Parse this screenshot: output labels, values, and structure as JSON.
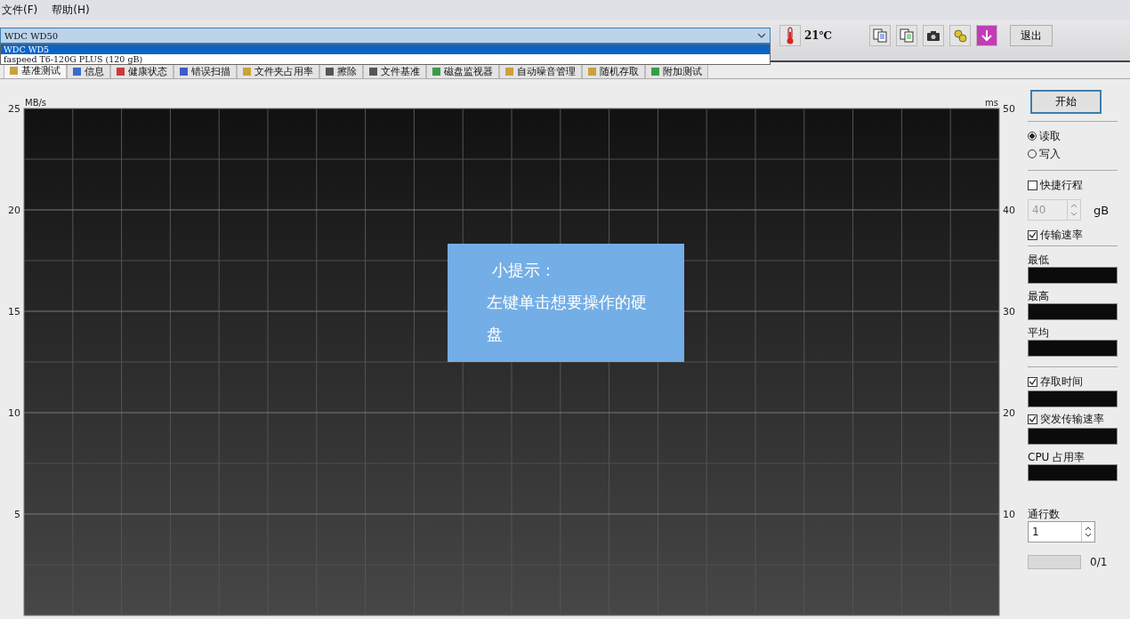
{
  "menu": [
    "文件(F)",
    "帮助(H)"
  ],
  "drive_select": {
    "value": "WDC WD50",
    "options": [
      {
        "label": "WDC WD5",
        "selected": true
      },
      {
        "label": "faspeed T6-120G PLUS (120 gB)",
        "selected": false
      }
    ]
  },
  "temperature": "21℃",
  "exit_button": "退出",
  "tabs": [
    {
      "label": "基准测试",
      "selected": true
    },
    {
      "label": "信息",
      "selected": false
    },
    {
      "label": "健康状态",
      "selected": false
    },
    {
      "label": "错误扫描",
      "selected": false
    },
    {
      "label": "文件夹占用率",
      "selected": false
    },
    {
      "label": "擦除",
      "selected": false
    },
    {
      "label": "文件基准",
      "selected": false
    },
    {
      "label": "磁盘监视器",
      "selected": false
    },
    {
      "label": "自动噪音管理",
      "selected": false
    },
    {
      "label": "随机存取",
      "selected": false
    },
    {
      "label": "附加测试",
      "selected": false
    }
  ],
  "chart": {
    "left_axis": {
      "label": "MB/s",
      "ticks": [
        "25",
        "20",
        "15",
        "10",
        "5"
      ]
    },
    "right_axis": {
      "label": "ms",
      "ticks": [
        "50",
        "40",
        "30",
        "20",
        "10"
      ]
    }
  },
  "tip": {
    "title": "小提示：",
    "text": "左键单击想要操作的硬盘"
  },
  "panel": {
    "start_button": "开始",
    "modes": [
      {
        "label": "读取",
        "selected": true
      },
      {
        "label": "写入",
        "selected": false
      }
    ],
    "short_stroke": {
      "label": "快捷行程",
      "checked": false
    },
    "stroke_value": "40",
    "stroke_unit": "gB",
    "transfer_rate": {
      "label": "传输速率",
      "checked": true
    },
    "readouts": [
      "最低",
      "最高",
      "平均"
    ],
    "access_time": {
      "label": "存取时间",
      "checked": true
    },
    "burst_rate": {
      "label": "突发传输速率",
      "checked": true
    },
    "cpu_label": "CPU 占用率",
    "passes_label": "通行数",
    "passes_value": "1",
    "progress": {
      "level": 0,
      "text": "0/1"
    }
  }
}
